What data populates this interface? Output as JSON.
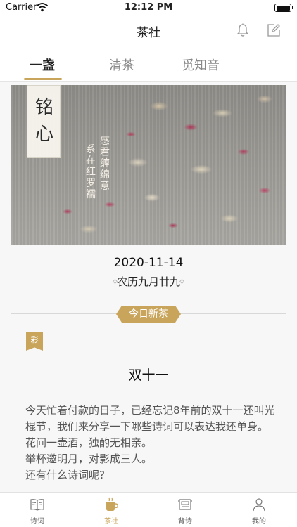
{
  "status_bar": {
    "carrier": "Carrier",
    "time": "12:12 PM"
  },
  "nav": {
    "title": "茶社",
    "icons": [
      "bell-icon",
      "edit-icon"
    ]
  },
  "tabs": [
    {
      "label": "一盏",
      "active": true
    },
    {
      "label": "清茶",
      "active": false
    },
    {
      "label": "觅知音",
      "active": false
    }
  ],
  "banner": {
    "card_text": "铭心",
    "verse_lines": [
      "感君缠绵意",
      "系在红罗襦"
    ]
  },
  "date": "2020-11-14",
  "lunar_date": "农历九月廿九",
  "today_badge": "今日新茶",
  "tag": "彩",
  "article": {
    "title": "双十一",
    "body": [
      "今天忙着付款的日子，已经忘记8年前的双十一还叫光棍节，我们来分享一下哪些诗词可以表达我还单身。",
      "花间一壶酒，独酌无相亲。",
      "举杯邀明月，对影成三人。",
      "还有什么诗词呢?"
    ]
  },
  "bottom_tabs": [
    {
      "label": "诗词",
      "icon": "book-icon",
      "active": false
    },
    {
      "label": "茶社",
      "icon": "tea-cup-icon",
      "active": true
    },
    {
      "label": "背诗",
      "icon": "scroll-icon",
      "active": false
    },
    {
      "label": "我的",
      "icon": "user-icon",
      "active": false
    }
  ],
  "colors": {
    "accent": "#c9a55b",
    "background": "#f7f7f7"
  }
}
